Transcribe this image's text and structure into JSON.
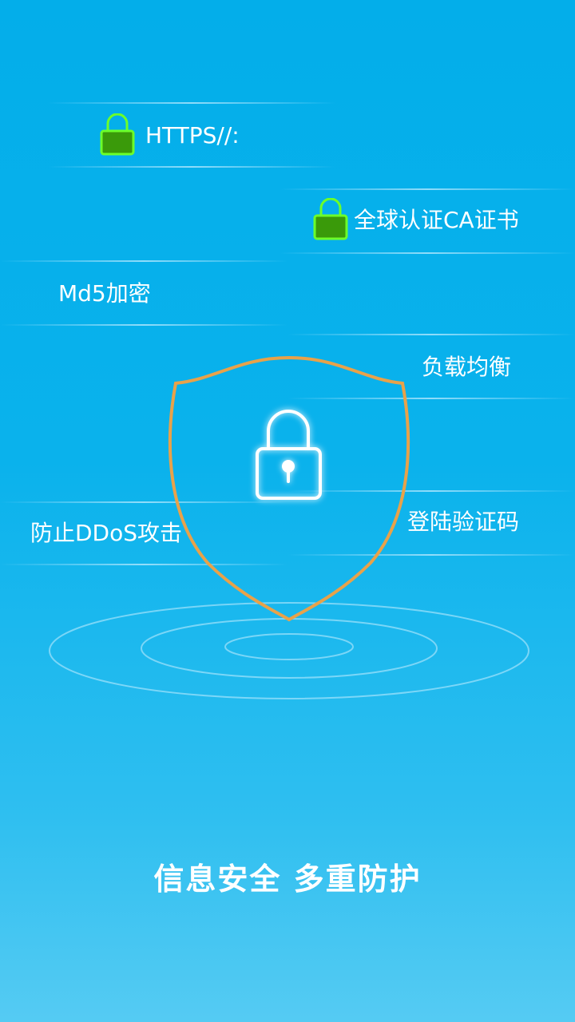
{
  "features": {
    "https": "HTTPS//:",
    "ca_cert": "全球认证CA证书",
    "md5": "Md5加密",
    "load_balance": "负载均衡",
    "ddos": "防止DDoS攻击",
    "login_captcha": "登陆验证码"
  },
  "slogan": "信息安全 多重防护",
  "colors": {
    "background_top": "#03aeea",
    "background_bottom": "#55cbf3",
    "shield_outline": "#e8a24a",
    "lock_badge_fill": "#3a9a0a",
    "lock_badge_stroke": "#6cff2a"
  },
  "icons": {
    "badge": "padlock-icon",
    "center": "padlock-icon",
    "shield": "shield-icon"
  }
}
